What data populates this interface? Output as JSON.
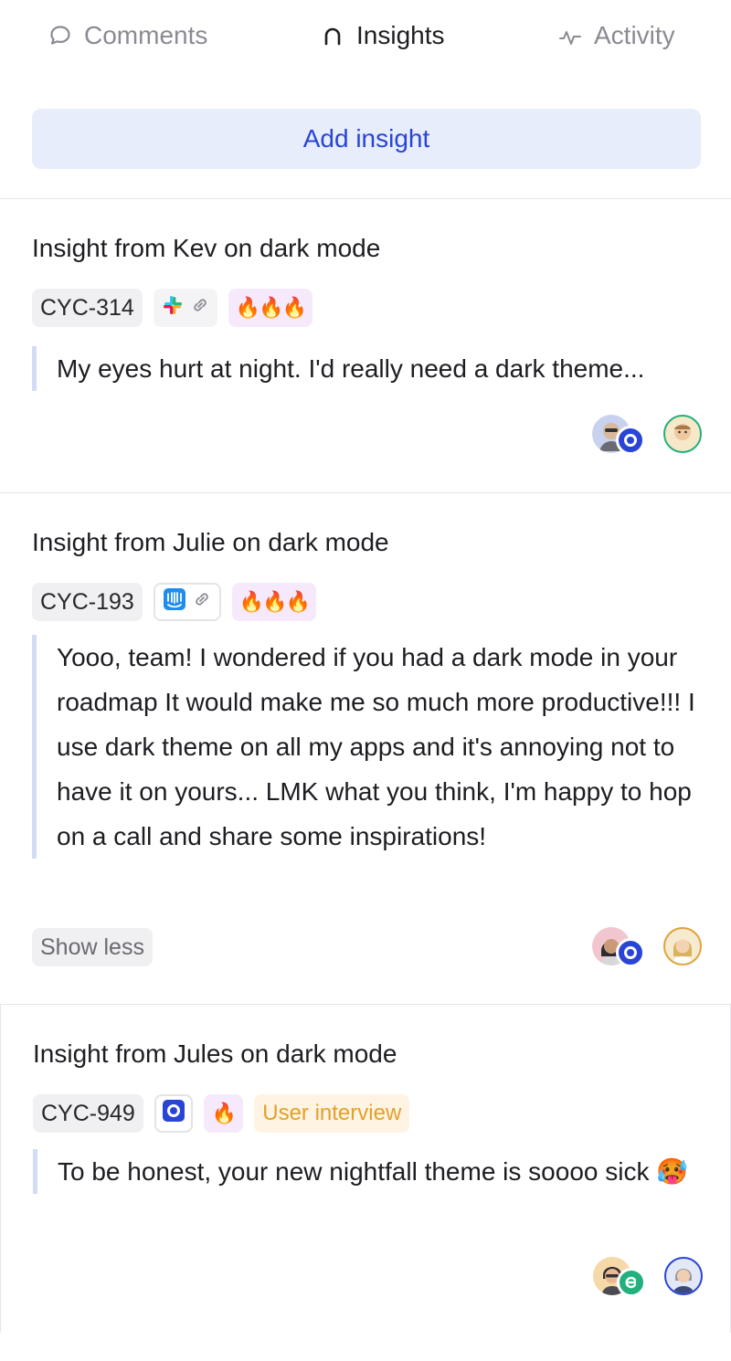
{
  "tabs": [
    {
      "label": "Comments",
      "icon": "comment-icon",
      "active": false
    },
    {
      "label": "Insights",
      "icon": "insights-icon",
      "active": true
    },
    {
      "label": "Activity",
      "icon": "activity-icon",
      "active": false
    }
  ],
  "add_insight_label": "Add insight",
  "colors": {
    "accent": "#2945d6",
    "accent_bg": "#e8edfc",
    "quote_bar": "#d3dbf6",
    "tag_orange": "#e3a02a"
  },
  "insights": [
    {
      "title": "Insight from Kev on dark mode",
      "id": "CYC-314",
      "source_icons": [
        "slack-icon",
        "link-icon"
      ],
      "fire": "🔥🔥🔥",
      "quote": "My eyes hurt at night. I'd really need a dark theme...",
      "avatars": [
        "customer-avatar",
        "cycle-badge-icon",
        "assignee-avatar"
      ]
    },
    {
      "title": "Insight from Julie on dark mode",
      "id": "CYC-193",
      "source_icons": [
        "intercom-icon",
        "link-icon"
      ],
      "fire": "🔥🔥🔥",
      "quote": "Yooo, team! I wondered if you had a dark mode in your roadmap It would make me so much more productive!!! I use dark theme on all my apps and it's annoying not to have it on yours... LMK what you think, I'm happy to hop on a call and share some inspirations!",
      "show_less": "Show less",
      "avatars": [
        "customer-avatar",
        "cycle-badge-icon",
        "assignee-avatar"
      ]
    },
    {
      "title": "Insight from Jules on dark mode",
      "id": "CYC-949",
      "source_icons": [
        "cycle-icon"
      ],
      "fire": "🔥",
      "tag": "User interview",
      "quote": "To be honest, your new nightfall theme is soooo sick 🥵",
      "avatars": [
        "customer-avatar",
        "green-badge-icon",
        "assignee-avatar"
      ]
    }
  ]
}
